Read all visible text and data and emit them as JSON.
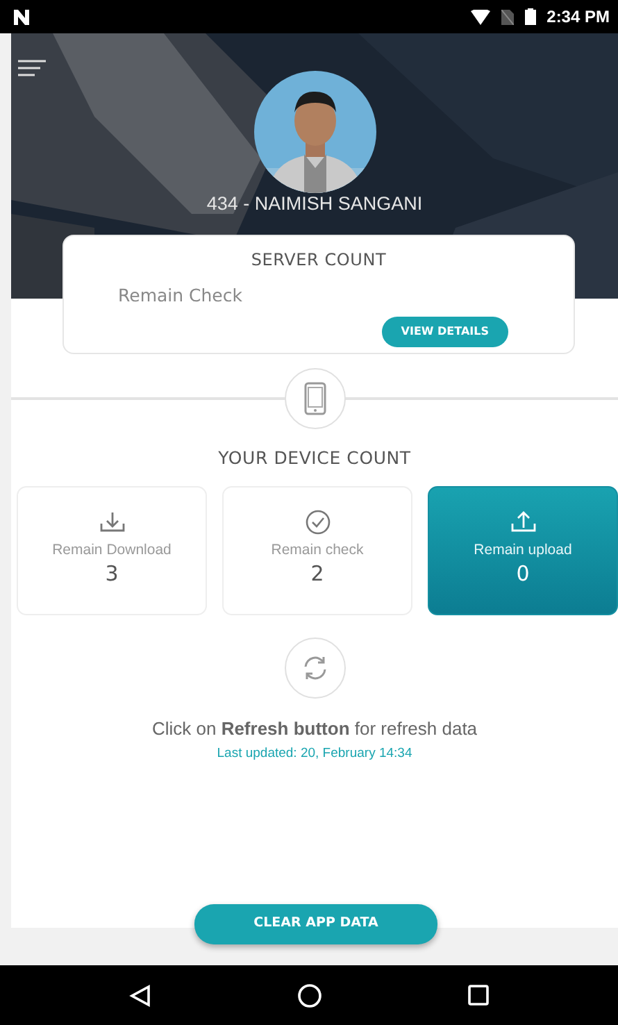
{
  "status_bar": {
    "time": "2:34 PM"
  },
  "profile": {
    "name": "434 - NAIMISH SANGANI"
  },
  "server_count": {
    "title": "SERVER COUNT",
    "label": "Remain Check",
    "button": "VIEW DETAILS"
  },
  "device_count": {
    "title": "YOUR DEVICE COUNT",
    "cards": [
      {
        "kind": "download",
        "label": "Remain Download",
        "value": "3",
        "selected": false
      },
      {
        "kind": "check",
        "label": "Remain check",
        "value": "2",
        "selected": false
      },
      {
        "kind": "upload",
        "label": "Remain upload",
        "value": "0",
        "selected": true
      }
    ]
  },
  "refresh": {
    "message": "Click on **Refresh button** for refresh data",
    "last_updated": "Last updated: 20, February 14:34"
  },
  "clear_button": "CLEAR APP DATA"
}
